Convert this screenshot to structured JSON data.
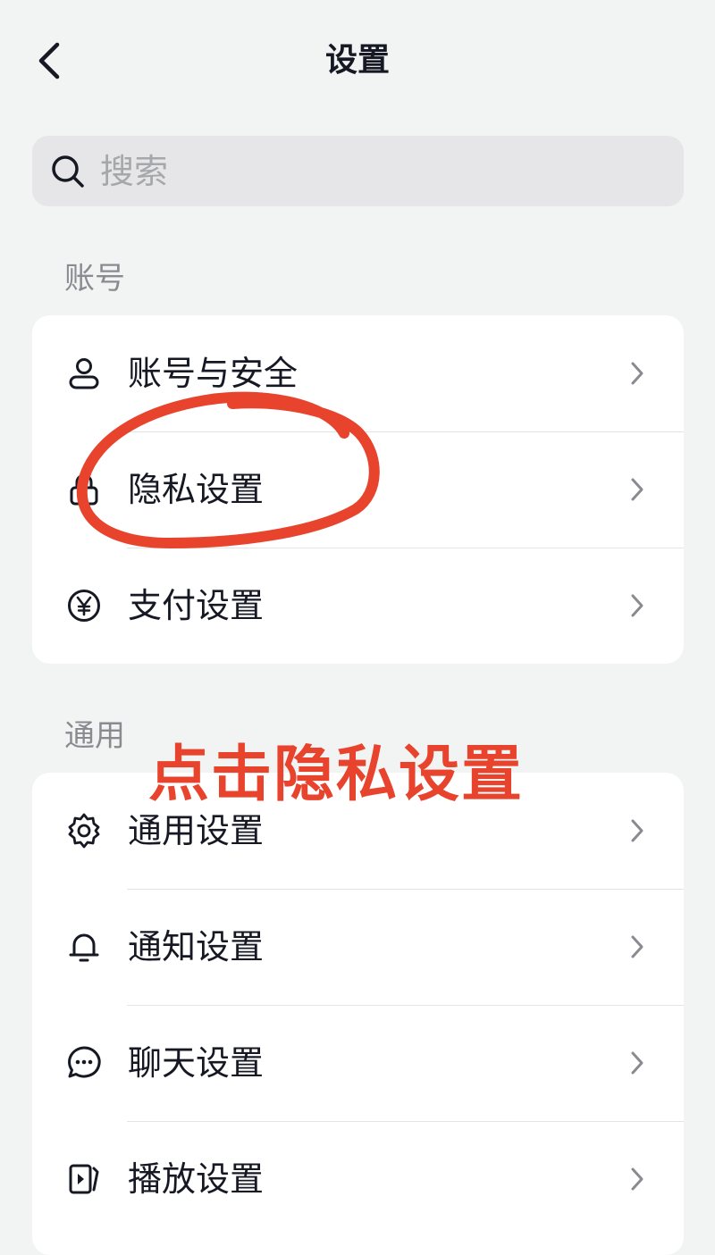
{
  "header": {
    "title": "设置",
    "back_icon": "chevron-left-icon"
  },
  "search": {
    "placeholder": "搜索",
    "value": "",
    "icon": "search-icon"
  },
  "sections": [
    {
      "label": "账号",
      "items": [
        {
          "label": "账号与安全",
          "icon": "user-icon"
        },
        {
          "label": "隐私设置",
          "icon": "lock-icon"
        },
        {
          "label": "支付设置",
          "icon": "yen-icon"
        }
      ]
    },
    {
      "label": "通用",
      "items": [
        {
          "label": "通用设置",
          "icon": "gear-icon"
        },
        {
          "label": "通知设置",
          "icon": "bell-icon"
        },
        {
          "label": "聊天设置",
          "icon": "chat-icon"
        },
        {
          "label": "播放设置",
          "icon": "play-icon"
        }
      ]
    }
  ],
  "annotation": {
    "text": "点击隐私设置",
    "color": "#e8432d",
    "highlighted_item": "隐私设置"
  },
  "colors": {
    "background": "#f2f3f3",
    "card": "#ffffff",
    "text": "#161823",
    "secondary_text": "#8a8b91",
    "search_bg": "#e6e6e8"
  }
}
